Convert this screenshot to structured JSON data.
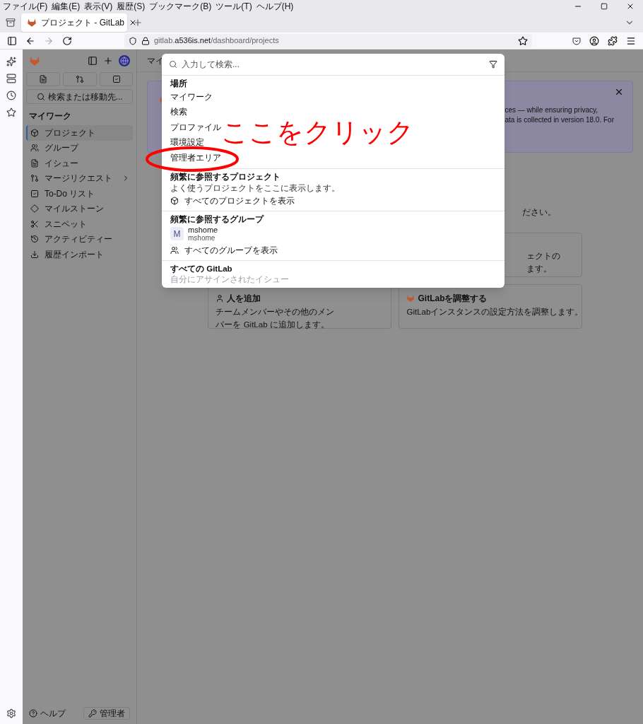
{
  "browser": {
    "menu": [
      "ファイル(F)",
      "編集(E)",
      "表示(V)",
      "履歴(S)",
      "ブックマーク(B)",
      "ツール(T)",
      "ヘルプ(H)"
    ],
    "tabs": [
      {
        "title": "プロジェクト - GitLab",
        "selected": true
      }
    ],
    "url": "gitlab.**a536is.net**/dashboard/projects"
  },
  "sidebar": {
    "search": "検索または移動先...",
    "section": "マイワーク",
    "items": [
      {
        "label": "プロジェクト",
        "selected": true,
        "expandable": false
      },
      {
        "label": "グループ",
        "selected": false,
        "expandable": false
      },
      {
        "label": "イシュー",
        "selected": false,
        "expandable": false
      },
      {
        "label": "マージリクエスト",
        "selected": false,
        "expandable": true
      },
      {
        "label": "To-Do リスト",
        "selected": false,
        "expandable": false
      },
      {
        "label": "マイルストーン",
        "selected": false,
        "expandable": false
      },
      {
        "label": "スニペット",
        "selected": false,
        "expandable": false
      },
      {
        "label": "アクティビティー",
        "selected": false,
        "expandable": false
      },
      {
        "label": "履歴インポート",
        "selected": false,
        "expandable": false
      }
    ],
    "help": "ヘルプ",
    "admin": "管理者"
  },
  "main": {
    "breadcrumb": "マイ",
    "banner": {
      "lines": [
        "ces — while ensuring privacy,",
        "ata is collected in version 18.0. For"
      ]
    },
    "notice": "ださい。",
    "cards": [
      {
        "lines": [
          "ェクトの",
          "ます。"
        ]
      },
      {
        "title": "人を追加",
        "lines": [
          "チームメンバーやその他のメン",
          "バーを GitLab に追加します。"
        ]
      },
      {
        "title": "GitLabを調整する",
        "lines": [
          "GitLabインスタンスの設定方法を調整します。"
        ]
      }
    ]
  },
  "search_modal": {
    "placeholder": "入力して検索...",
    "sections": [
      {
        "heading": "場所",
        "items": [
          {
            "kind": "plain",
            "label": "マイワーク"
          },
          {
            "kind": "plain",
            "label": "検索"
          },
          {
            "kind": "plain",
            "label": "プロファイル"
          },
          {
            "kind": "plain",
            "label": "環境設定"
          },
          {
            "kind": "plain",
            "label": "管理者エリア"
          }
        ]
      },
      {
        "heading": "頻繁に参照するプロジェクト",
        "description": "よく使うプロジェクトをここに表示します。",
        "items": [
          {
            "kind": "project-link",
            "label": "すべてのプロジェクトを表示"
          }
        ]
      },
      {
        "heading": "頻繁に参照するグループ",
        "items": [
          {
            "kind": "group",
            "avatar": "M",
            "label": "mshome",
            "sublabel": "mshome"
          },
          {
            "kind": "group-link",
            "label": "すべてのグループを表示"
          }
        ]
      },
      {
        "heading": "すべての GitLab",
        "items": [
          {
            "kind": "faded",
            "label": "自分にアサインされたイシュー"
          }
        ]
      }
    ]
  },
  "annotation": {
    "text": "ここをクリック"
  }
}
